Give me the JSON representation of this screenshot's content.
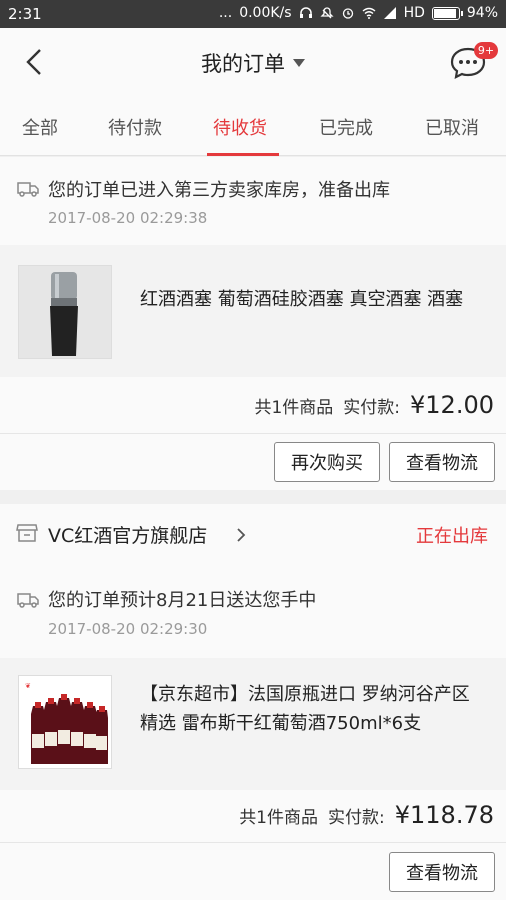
{
  "status_bar": {
    "time": "2:31",
    "dots": "...",
    "speed": "0.00K/s",
    "network": "HD",
    "battery": "94%",
    "battery_level": 0.94
  },
  "header": {
    "title": "我的订单",
    "badge": "9+"
  },
  "tabs": [
    {
      "label": "全部"
    },
    {
      "label": "待付款"
    },
    {
      "label": "待收货",
      "active": true
    },
    {
      "label": "已完成"
    },
    {
      "label": "已取消"
    }
  ],
  "orders": [
    {
      "ship_message": "您的订单已进入第三方卖家库房，准备出库",
      "ship_time": "2017-08-20 02:29:38",
      "product_name": "红酒酒塞  葡萄酒硅胶酒塞 真空酒塞 酒塞",
      "count_label": "共1件商品",
      "paid_label": "实付款:",
      "price": "¥12.00",
      "buttons": [
        "再次购买",
        "查看物流"
      ]
    },
    {
      "store_name": "VC红酒官方旗舰店",
      "status": "正在出库",
      "ship_message": "您的订单预计8月21日送达您手中",
      "ship_time": "2017-08-20 02:29:30",
      "product_name": "【京东超市】法国原瓶进口 罗纳河谷产区精选 雷布斯干红葡萄酒750ml*6支",
      "count_label": "共1件商品",
      "paid_label": "实付款:",
      "price": "¥118.78",
      "buttons": [
        "查看物流"
      ]
    }
  ],
  "colors": {
    "accent": "#e4393c",
    "status_bar": "#3a3a3a",
    "background": "#f0f0f0"
  }
}
